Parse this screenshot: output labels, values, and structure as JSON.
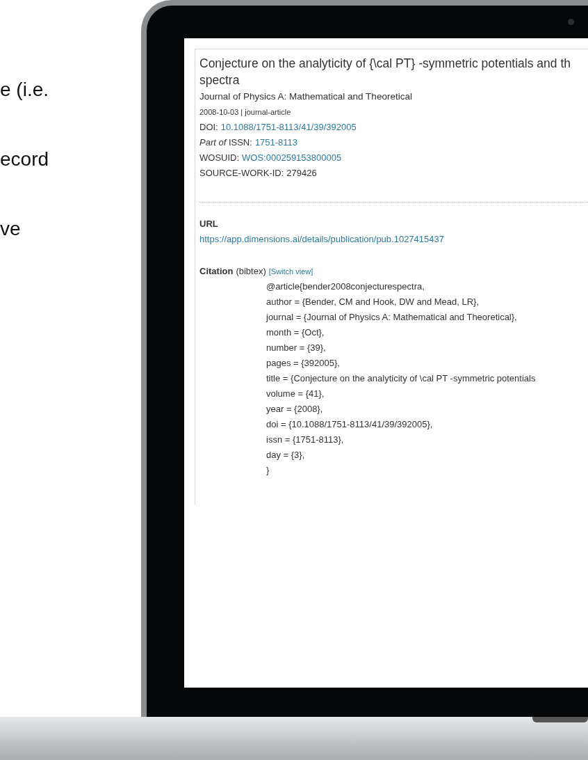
{
  "side_text": [
    "e (i.e.",
    "ecord",
    "ve"
  ],
  "record": {
    "title_lines": [
      "Conjecture on the analyticity of {\\cal PT} -symmetric potentials and th",
      "spectra"
    ],
    "journal": "Journal of Physics A: Mathematical and Theoretical",
    "date_type": "2008-10-03 | journal-article",
    "identifiers": [
      {
        "label": "DOI:",
        "value": "10.1088/1751-8113/41/39/392005",
        "link": true
      },
      {
        "label": "*Part of* ISSN:",
        "value": "1751-8113",
        "link": true
      },
      {
        "label": "WOSUID:",
        "value": "WOS:000259153800005",
        "link": true
      },
      {
        "label": "SOURCE-WORK-ID:",
        "value": "279426",
        "link": false
      }
    ]
  },
  "url": {
    "heading": "URL",
    "link": "https://app.dimensions.ai/details/publication/pub.1027415437"
  },
  "citation": {
    "heading": "Citation",
    "format": "(bibtex)",
    "switch": "[Switch view]",
    "lines": [
      "@article{bender2008conjecturespectra,",
      "author = {Bender, CM and Hook, DW and Mead, LR},",
      "journal = {Journal of Physics A: Mathematical and Theoretical},",
      "month = {Oct},",
      "number = {39},",
      "pages = {392005},",
      "title = {Conjecture on the analyticity of \\cal PT -symmetric potentials",
      "volume = {41},",
      "year = {2008},",
      "doi = {10.1088/1751-8113/41/39/392005},",
      "issn = {1751-8113},",
      "day = {3},",
      "}"
    ]
  }
}
